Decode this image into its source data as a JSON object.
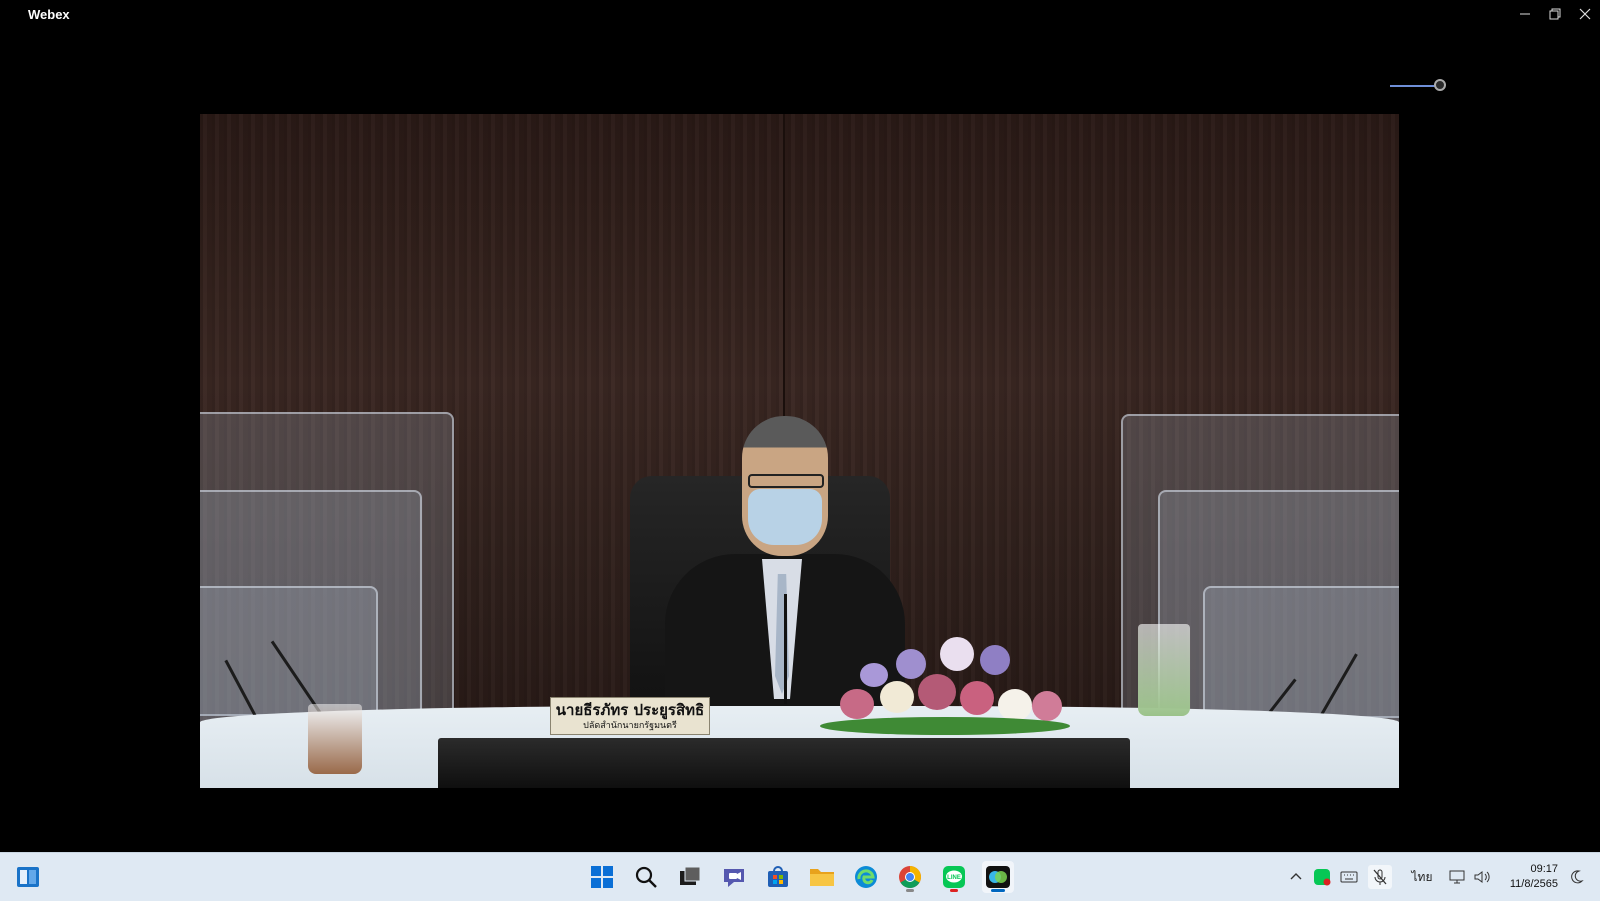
{
  "window": {
    "title": "Webex"
  },
  "video": {
    "nameplate_name": "นายธีรภัทร ประยูรสิทธิ",
    "nameplate_position": "ปลัดสำนักนายกรัฐมนตรี"
  },
  "taskbar": {
    "apps": [
      "windows-start",
      "search",
      "task-view",
      "teams-chat",
      "microsoft-store",
      "file-explorer",
      "edge",
      "chrome",
      "line",
      "webex"
    ],
    "tray": {
      "language": "ไทย",
      "time": "09:17",
      "date": "11/8/2565"
    }
  },
  "colors": {
    "taskbar_bg": "#dfe9f3",
    "accent": "#0067c0",
    "line_green": "#06c755"
  }
}
